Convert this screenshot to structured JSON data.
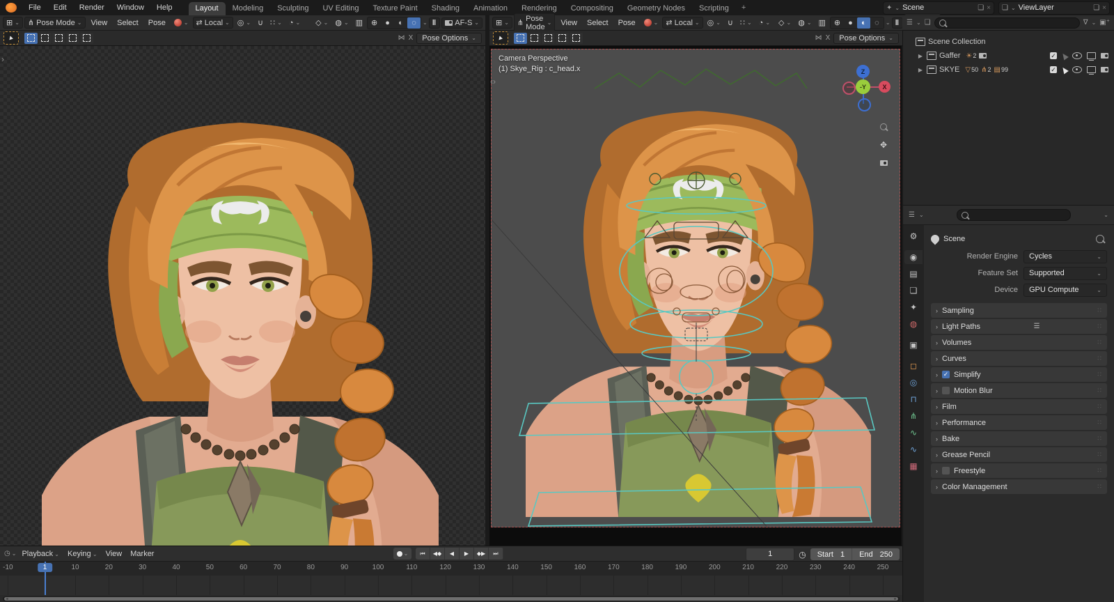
{
  "colors": {
    "accent_blue": "#4772b3",
    "playhead_blue": "#4a7fd1",
    "rig_teal": "#59c8c2",
    "camera_dash_red": "#a85050",
    "viewport_bg": "#4c4c4c",
    "hair_orange": "#d98f45",
    "bandana_green": "#9cba5c"
  },
  "topbar": {
    "menus": [
      "File",
      "Edit",
      "Render",
      "Window",
      "Help"
    ],
    "workspaces": [
      "Layout",
      "Modeling",
      "Sculpting",
      "UV Editing",
      "Texture Paint",
      "Shading",
      "Animation",
      "Rendering",
      "Compositing",
      "Geometry Nodes",
      "Scripting"
    ],
    "active_workspace": "Layout",
    "new_workspace_label": "+",
    "scene_selector": {
      "value": "Scene"
    },
    "viewlayer_selector": {
      "value": "ViewLayer"
    }
  },
  "viewport_header": {
    "mode": "Pose Mode",
    "menus": [
      "View",
      "Select",
      "Pose"
    ],
    "orientation": "Local",
    "camera_widget": "AF-S",
    "pose_options": "Pose Options",
    "mirror_x": "X"
  },
  "viewport_left": {
    "shading_active": "rendered"
  },
  "viewport_right": {
    "shading_active": "material",
    "overlay_line1": "Camera Perspective",
    "overlay_line2": "(1) Skye_Rig : c_head.x",
    "axis": {
      "top": "Z",
      "center": "-Y",
      "right": "X"
    }
  },
  "outliner": {
    "rows": [
      {
        "label": "Scene Collection",
        "indent": 0,
        "expander": "",
        "badges": [],
        "toggles": []
      },
      {
        "label": "Gaffer",
        "indent": 1,
        "expander": "▶",
        "badges": [
          {
            "icon": "light-icon",
            "glyph": "☀",
            "count": "2"
          },
          {
            "icon": "camera-data-icon",
            "glyph": "",
            "count": ""
          }
        ],
        "toggles": [
          "checkbox",
          "cursor-dim",
          "eye",
          "monitor",
          "camera"
        ]
      },
      {
        "label": "SKYE",
        "indent": 1,
        "expander": "▶",
        "badges": [
          {
            "icon": "mesh-icon",
            "glyph": "▽",
            "count": "50"
          },
          {
            "icon": "armature-icon",
            "glyph": "⋔",
            "count": "2"
          },
          {
            "icon": "image-icon",
            "glyph": "▤",
            "count": "99"
          }
        ],
        "toggles": [
          "checkbox",
          "cursor",
          "eye",
          "monitor",
          "camera"
        ]
      }
    ]
  },
  "properties": {
    "breadcrumb": "Scene",
    "fields": [
      {
        "label": "Render Engine",
        "value": "Cycles"
      },
      {
        "label": "Feature Set",
        "value": "Supported"
      },
      {
        "label": "Device",
        "value": "GPU Compute"
      }
    ],
    "sections": [
      {
        "label": "Sampling",
        "checkbox": null,
        "extra": null
      },
      {
        "label": "Light Paths",
        "checkbox": null,
        "extra": "list"
      },
      {
        "label": "Volumes",
        "checkbox": null,
        "extra": null
      },
      {
        "label": "Curves",
        "checkbox": null,
        "extra": null
      },
      {
        "label": "Simplify",
        "checkbox": true,
        "extra": null
      },
      {
        "label": "Motion Blur",
        "checkbox": false,
        "extra": null
      },
      {
        "label": "Film",
        "checkbox": null,
        "extra": null
      },
      {
        "label": "Performance",
        "checkbox": null,
        "extra": null
      },
      {
        "label": "Bake",
        "checkbox": null,
        "extra": null
      },
      {
        "label": "Grease Pencil",
        "checkbox": null,
        "extra": null
      },
      {
        "label": "Freestyle",
        "checkbox": false,
        "extra": null
      },
      {
        "label": "Color Management",
        "checkbox": null,
        "extra": null
      }
    ],
    "tabs": [
      {
        "name": "tool",
        "glyph": "⚙",
        "color": "#c4c4c4",
        "active": false
      },
      {
        "name": "render",
        "glyph": "◉",
        "color": "#c4c4c4",
        "active": true
      },
      {
        "name": "output",
        "glyph": "▤",
        "color": "#c4c4c4",
        "active": false
      },
      {
        "name": "view-layer",
        "glyph": "❏",
        "color": "#c4c4c4",
        "active": false
      },
      {
        "name": "scene",
        "glyph": "✦",
        "color": "#c4c4c4",
        "active": false
      },
      {
        "name": "world",
        "glyph": "◍",
        "color": "#cf6a6a",
        "active": false
      },
      {
        "name": "collection",
        "glyph": "▣",
        "color": "#c4c4c4",
        "active": false
      },
      {
        "name": "object",
        "glyph": "◻",
        "color": "#e39b52",
        "active": false
      },
      {
        "name": "physics",
        "glyph": "◎",
        "color": "#6fa3d8",
        "active": false
      },
      {
        "name": "constraints",
        "glyph": "⊓",
        "color": "#6fa3d8",
        "active": false
      },
      {
        "name": "data",
        "glyph": "⋔",
        "color": "#6fc38f",
        "active": false
      },
      {
        "name": "bone",
        "glyph": "∿",
        "color": "#6fc38f",
        "active": false
      },
      {
        "name": "bone-constraint",
        "glyph": "∿",
        "color": "#6fa3d8",
        "active": false
      },
      {
        "name": "texture",
        "glyph": "▦",
        "color": "#cf6a7a",
        "active": false
      }
    ]
  },
  "timeline": {
    "dropdown_menus": [
      "Playback",
      "Keying"
    ],
    "menus": [
      "View",
      "Marker"
    ],
    "transport": [
      {
        "name": "jump-to-start",
        "glyph": "⏮"
      },
      {
        "name": "prev-keyframe",
        "glyph": "◀◆"
      },
      {
        "name": "play-reverse",
        "glyph": "◀"
      },
      {
        "name": "play",
        "glyph": "▶"
      },
      {
        "name": "next-keyframe",
        "glyph": "◆▶"
      },
      {
        "name": "jump-to-end",
        "glyph": "⏭"
      }
    ],
    "current_frame": "1",
    "start_label": "Start",
    "start_value": "1",
    "end_label": "End",
    "end_value": "250",
    "ticks": [
      -10,
      10,
      20,
      30,
      40,
      50,
      60,
      70,
      80,
      90,
      100,
      110,
      120,
      130,
      140,
      150,
      160,
      170,
      180,
      190,
      200,
      210,
      220,
      230,
      240,
      250
    ]
  }
}
